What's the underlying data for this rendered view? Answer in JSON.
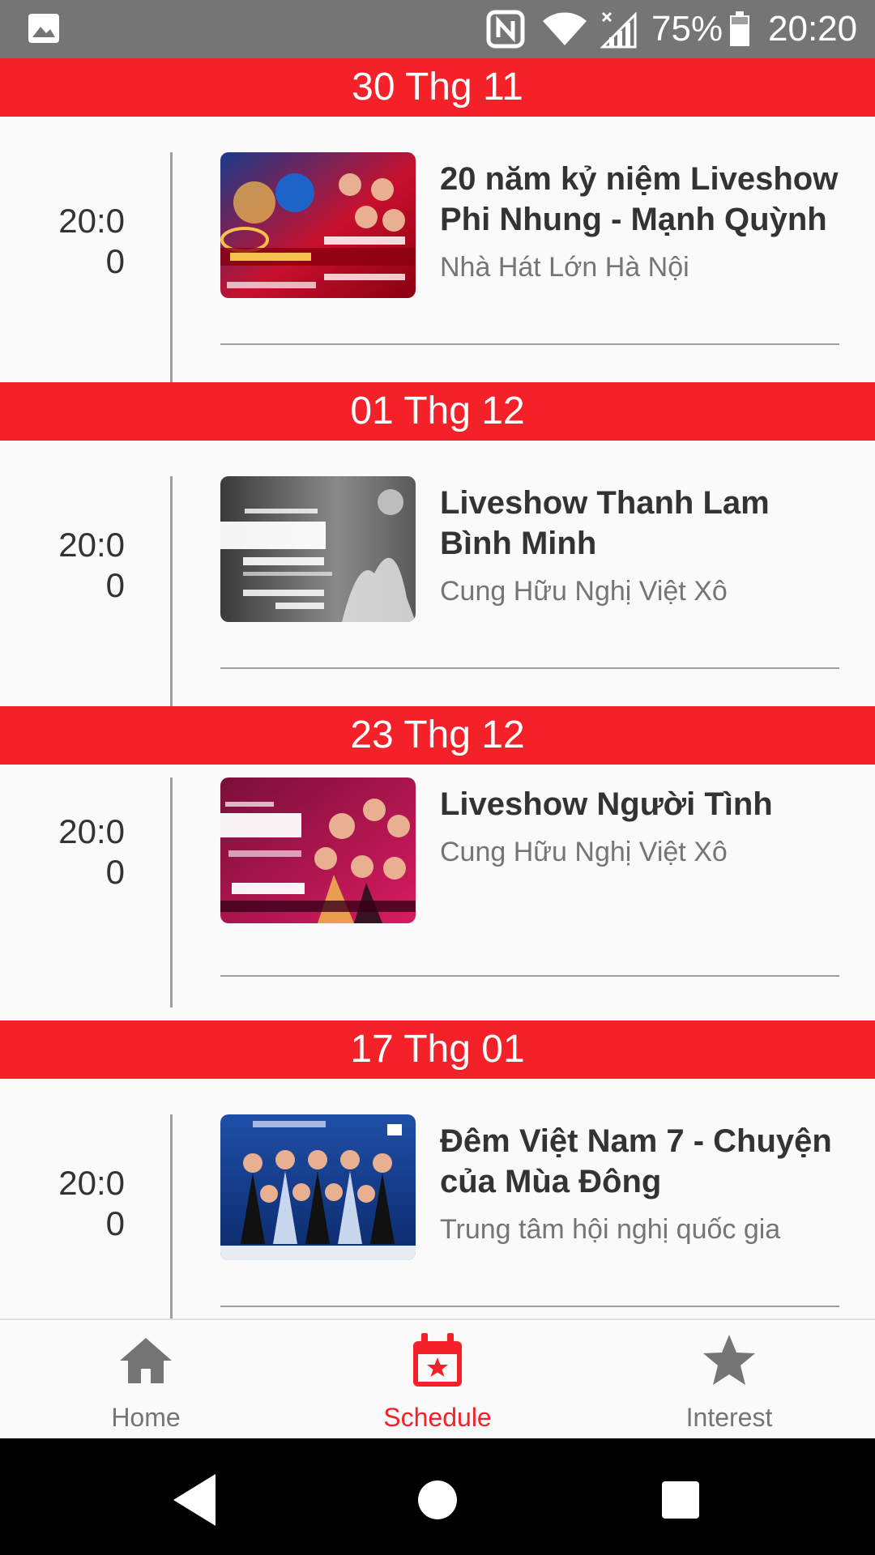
{
  "status_bar": {
    "battery_percent": "75%",
    "time": "20:20"
  },
  "schedule": [
    {
      "date": "30 Thg 11",
      "time": "20:0\n0",
      "title": "20 năm kỷ niệm Liveshow Phi Nhung - Mạnh Quỳnh",
      "venue": "Nhà Hát Lớn Hà Nội",
      "poster_colors": [
        "#c8102e",
        "#1a3a8a",
        "#f2c14e"
      ]
    },
    {
      "date": "01 Thg 12",
      "time": "20:0\n0",
      "title": "Liveshow Thanh Lam Bình Minh",
      "venue": "Cung Hữu Nghị Việt Xô",
      "poster_colors": [
        "#3a3a3a",
        "#8a8a8a",
        "#e0e0e0"
      ]
    },
    {
      "date": "23 Thg 12",
      "time": "20:0\n0",
      "title": "Liveshow Người Tình",
      "venue": "Cung Hữu Nghị Việt Xô",
      "poster_colors": [
        "#7a0f3a",
        "#d81b60",
        "#f8bbd0"
      ]
    },
    {
      "date": "17 Thg 01",
      "time": "20:0\n0",
      "title": "Đêm Việt Nam 7 - Chuyện của Mùa Đông",
      "venue": "Trung tâm hội nghị quốc gia",
      "poster_colors": [
        "#0d2a6b",
        "#1e4fa8",
        "#c9d6f0"
      ]
    }
  ],
  "bottom_nav": {
    "items": [
      {
        "label": "Home",
        "icon": "home-icon",
        "active": false
      },
      {
        "label": "Schedule",
        "icon": "calendar-star-icon",
        "active": true
      },
      {
        "label": "Interest",
        "icon": "star-icon",
        "active": false
      }
    ],
    "active_color": "#f52128",
    "inactive_color": "#757575"
  },
  "colors": {
    "accent": "#f52128",
    "status_bar": "#757575"
  }
}
